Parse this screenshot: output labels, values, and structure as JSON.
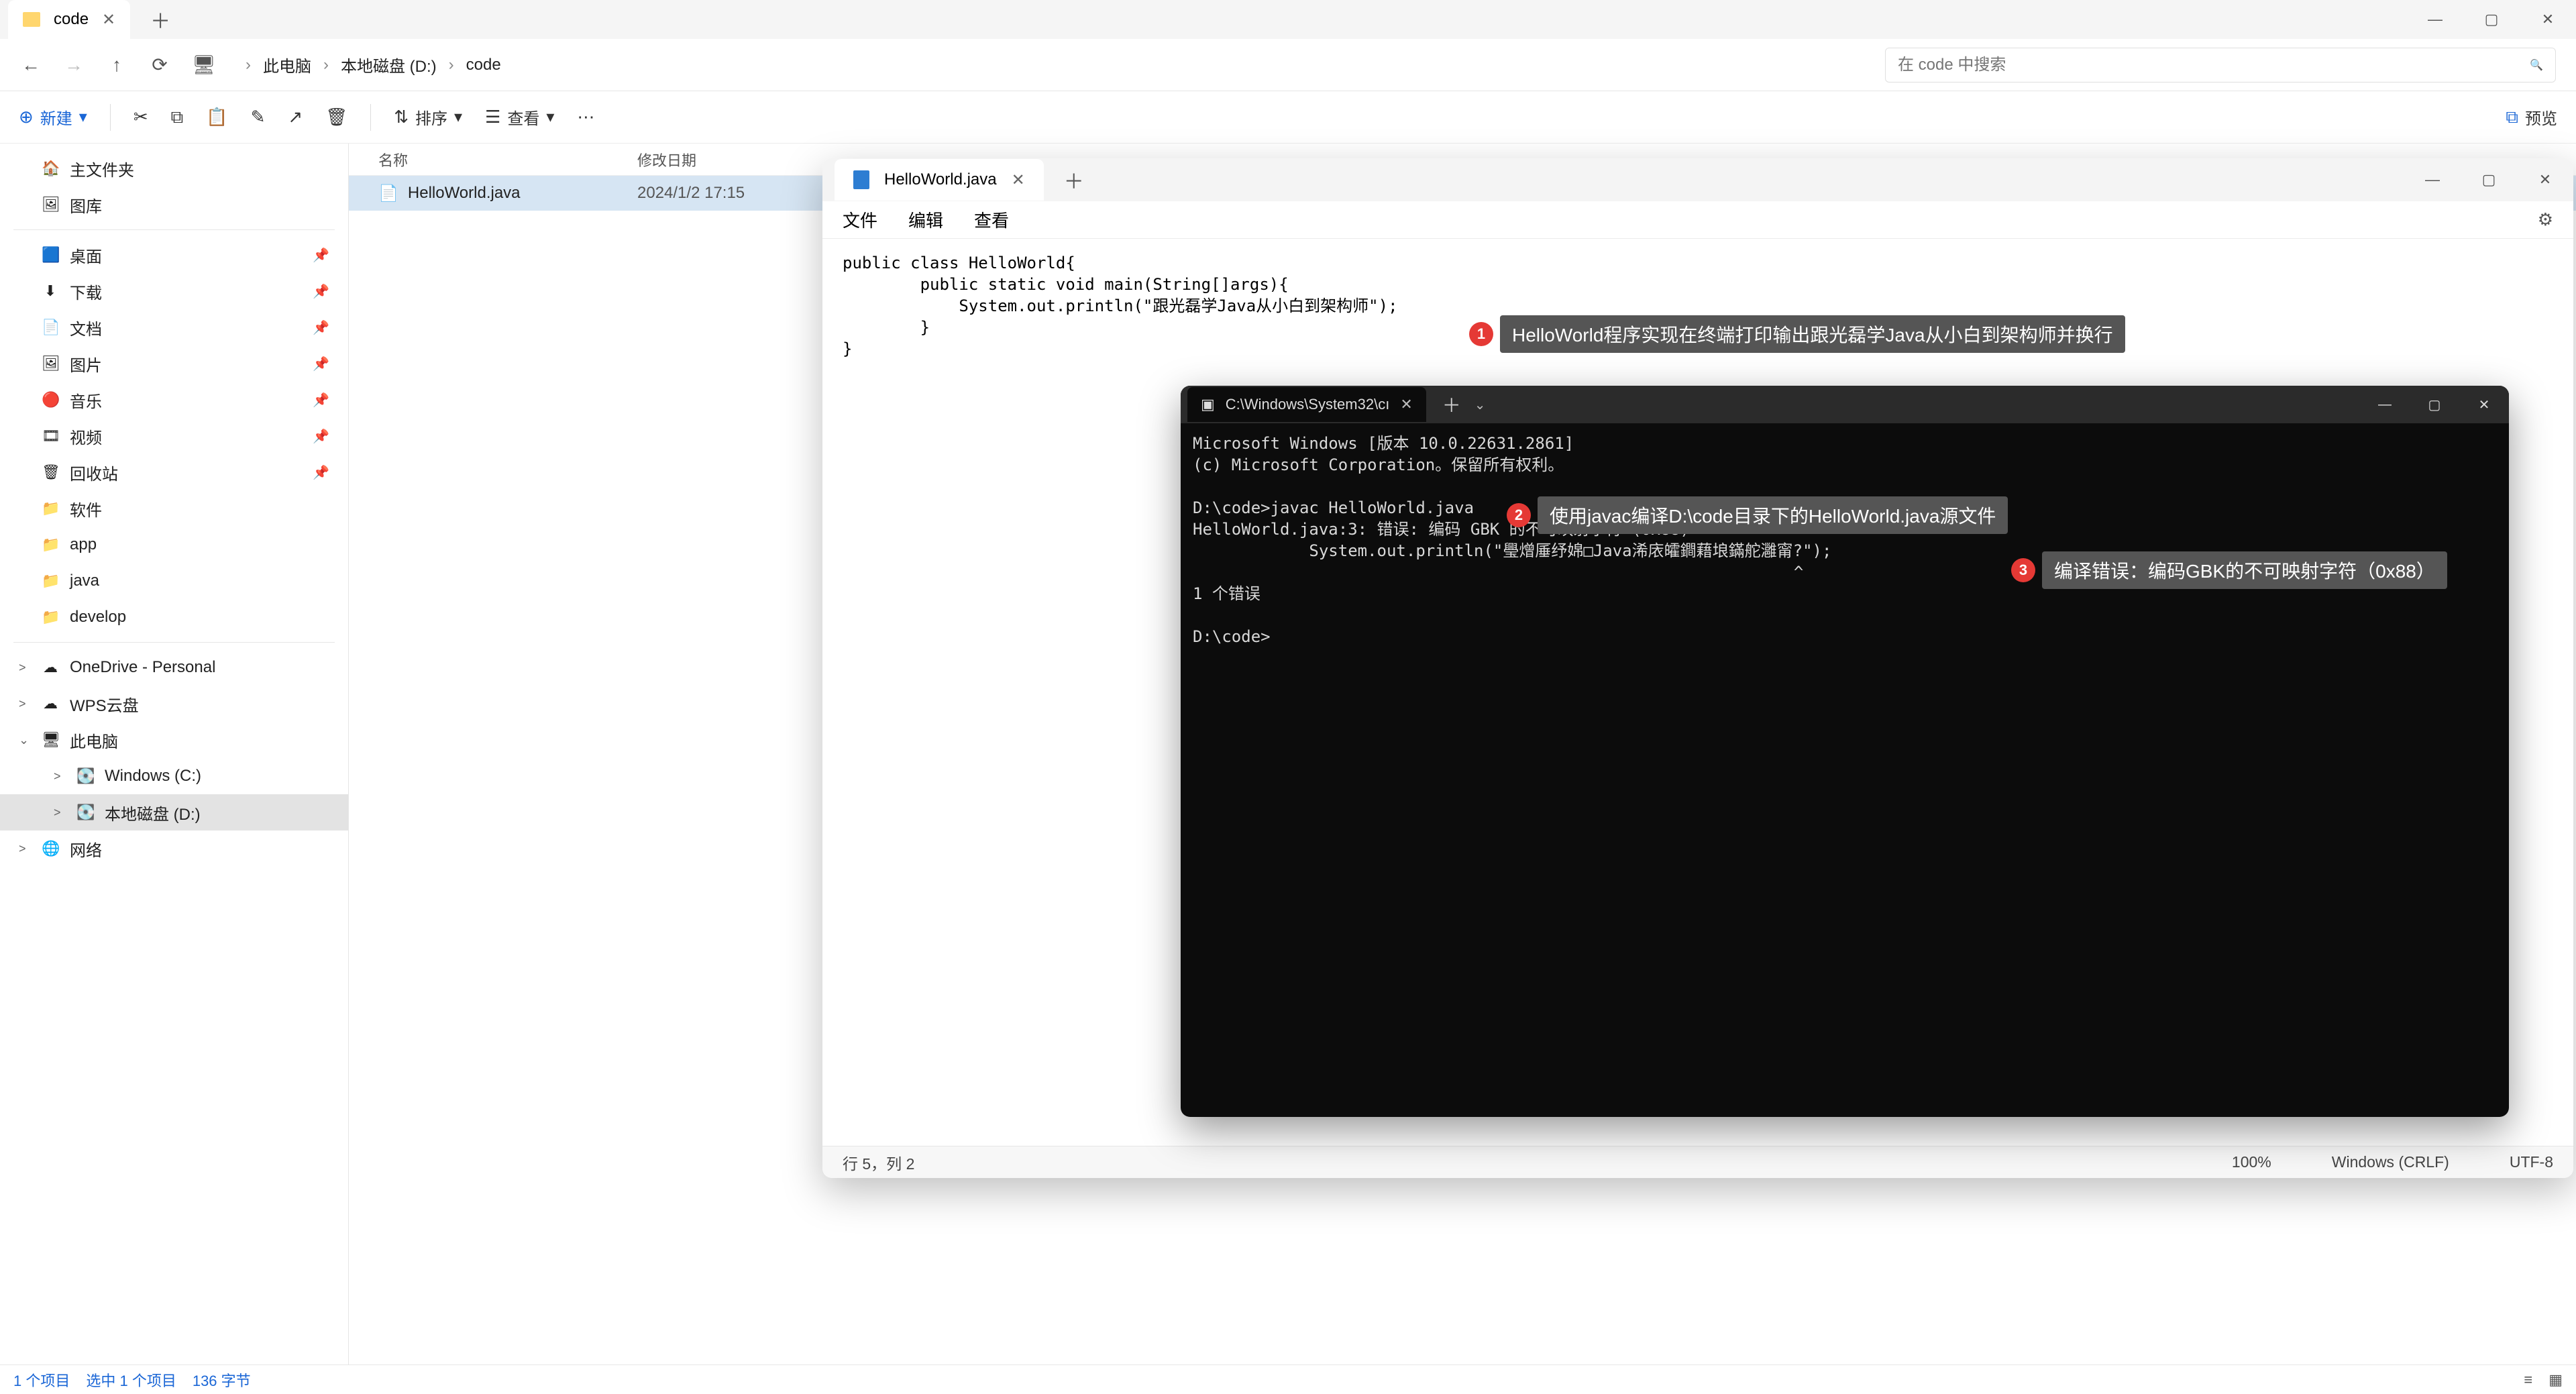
{
  "explorer": {
    "tab_title": "code",
    "breadcrumb": [
      "此电脑",
      "本地磁盘 (D:)",
      "code"
    ],
    "search_placeholder": "在 code 中搜索",
    "toolbar": {
      "new": "新建",
      "sort": "排序",
      "view": "查看",
      "preview": "预览"
    },
    "nav_top": [
      {
        "icon": "🏠",
        "label": "主文件夹"
      },
      {
        "icon": "🖼",
        "label": "图库"
      }
    ],
    "nav_pinned": [
      {
        "icon": "🟦",
        "label": "桌面"
      },
      {
        "icon": "⬇",
        "label": "下载"
      },
      {
        "icon": "📄",
        "label": "文档"
      },
      {
        "icon": "🖼",
        "label": "图片"
      },
      {
        "icon": "🔴",
        "label": "音乐"
      },
      {
        "icon": "🎞",
        "label": "视频"
      },
      {
        "icon": "🗑",
        "label": "回收站"
      },
      {
        "icon": "📁",
        "label": "软件"
      },
      {
        "icon": "📁",
        "label": "app"
      },
      {
        "icon": "📁",
        "label": "java"
      },
      {
        "icon": "📁",
        "label": "develop"
      }
    ],
    "nav_drives": [
      {
        "icon": "☁",
        "label": "OneDrive - Personal",
        "chev": ">"
      },
      {
        "icon": "☁",
        "label": "WPS云盘",
        "chev": ">"
      },
      {
        "icon": "🖥",
        "label": "此电脑",
        "chev": "⌄",
        "children": [
          {
            "icon": "💽",
            "label": "Windows (C:)",
            "chev": ">"
          },
          {
            "icon": "💽",
            "label": "本地磁盘 (D:)",
            "chev": ">",
            "selected": true
          }
        ]
      },
      {
        "icon": "🌐",
        "label": "网络",
        "chev": ">"
      }
    ],
    "columns": {
      "name": "名称",
      "date": "修改日期"
    },
    "files": [
      {
        "name": "HelloWorld.java",
        "date": "2024/1/2 17:15"
      }
    ],
    "status": {
      "count": "1 个项目",
      "selected": "选中 1 个项目",
      "bytes": "136 字节"
    }
  },
  "notepad": {
    "tab_title": "HelloWorld.java",
    "menu": {
      "file": "文件",
      "edit": "编辑",
      "view": "查看"
    },
    "code": "public class HelloWorld{\n        public static void main(String[]args){\n            System.out.println(\"跟光磊学Java从小白到架构师\");\n        }\n}",
    "status": {
      "pos": "行 5，列 2",
      "zoom": "100%",
      "eol": "Windows (CRLF)",
      "enc": "UTF-8"
    }
  },
  "terminal": {
    "tab_title": "C:\\Windows\\System32\\cı",
    "lines": [
      "Microsoft Windows [版本 10.0.22631.2861]",
      "(c) Microsoft Corporation。保留所有权利。",
      "",
      "D:\\code>javac HelloWorld.java",
      "HelloWorld.java:3: 错误: 编码 GBK 的不可映射字符 (0x88)",
      "            System.out.println(\"璺熷厜纾婂□Java浠庡皬鐧藉埌鏋舵灉甯?\");",
      "                                                              ^",
      "1 个错误",
      "",
      "D:\\code>"
    ]
  },
  "annotations": {
    "a1": "HelloWorld程序实现在终端打印输出跟光磊学Java从小白到架构师并换行",
    "a2": "使用javac编译D:\\code目录下的HelloWorld.java源文件",
    "a3": "编译错误：编码GBK的不可映射字符（0x88）"
  }
}
